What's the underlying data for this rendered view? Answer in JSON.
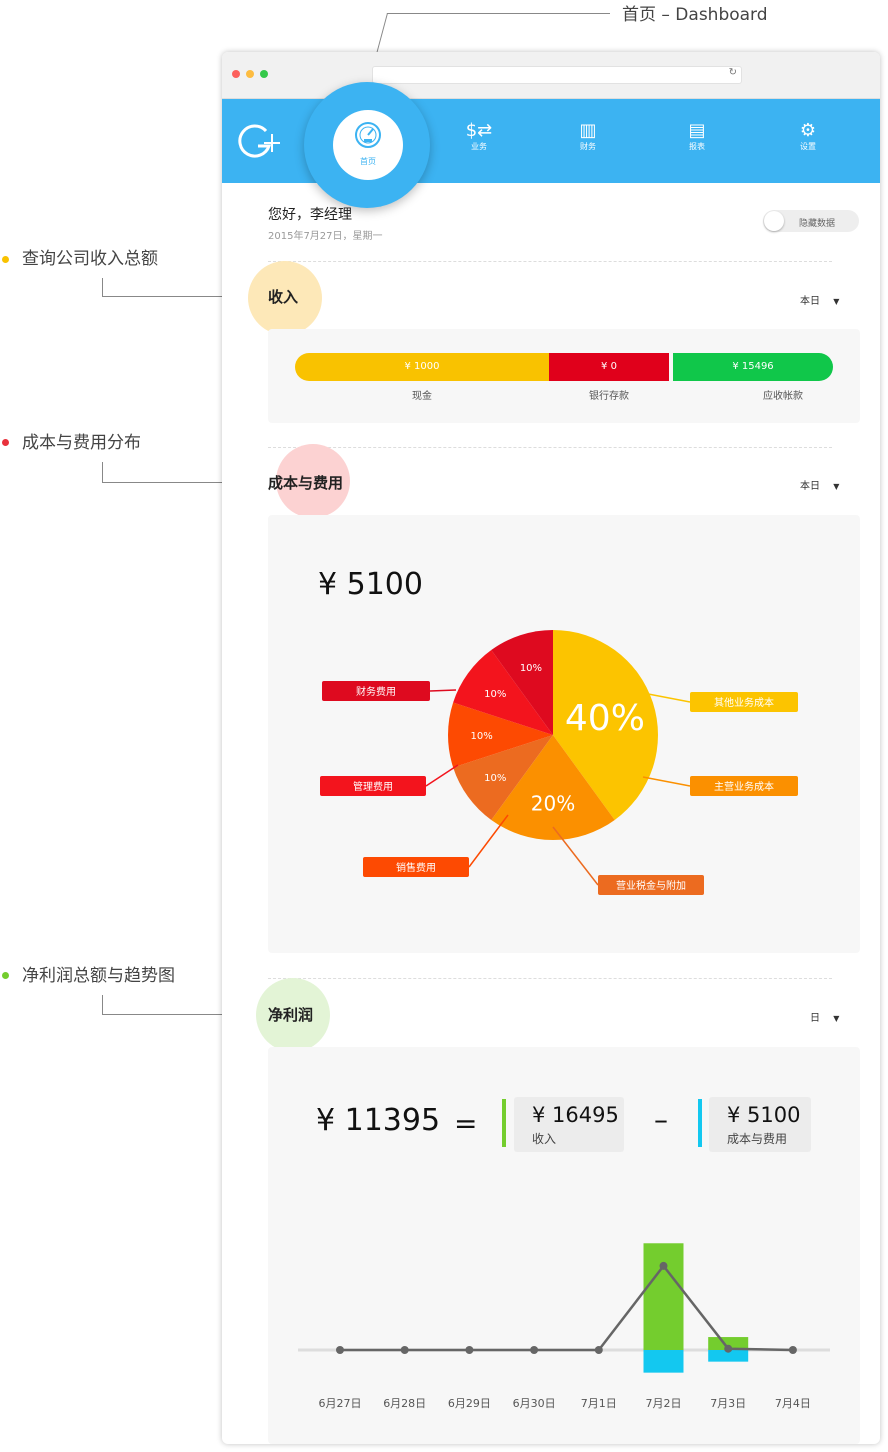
{
  "annotations": {
    "dashboard": "首页 – Dashboard",
    "income": "查询公司收入总额",
    "cost": "成本与费用分布",
    "profit": "净利润总额与趋势图"
  },
  "nav": {
    "home": "首页",
    "business": "业务",
    "finance": "财务",
    "report": "报表",
    "settings": "设置"
  },
  "greeting": {
    "name": "您好，李经理",
    "date": "2015年7月27日，星期一",
    "toggle_label": "隐藏数据"
  },
  "income": {
    "title": "收入",
    "period": "本日",
    "segments": [
      {
        "value": "¥ 1000",
        "label": "现金",
        "color": "#f9c200",
        "amount": 1000
      },
      {
        "value": "¥ 0",
        "label": "银行存款",
        "color": "#e0001b",
        "amount": 0
      },
      {
        "value": "¥ 15496",
        "label": "应收帐款",
        "color": "#10c74a",
        "amount": 15496
      }
    ]
  },
  "cost": {
    "title": "成本与费用",
    "period": "本日",
    "total": "¥ 5100"
  },
  "profit": {
    "title": "净利润",
    "period": "日",
    "total": "¥ 11395",
    "equals": "=",
    "minus": "–",
    "income_value": "¥ 16495",
    "income_label": "收入",
    "cost_value": "¥ 5100",
    "cost_label": "成本与费用"
  },
  "chart_data": [
    {
      "type": "pie",
      "title": "",
      "slices": [
        {
          "label": "其他业务成本",
          "value": 40,
          "text": "40%",
          "color": "#fcc400"
        },
        {
          "label": "主营业务成本",
          "value": 20,
          "text": "20%",
          "color": "#fb9000"
        },
        {
          "label": "营业税金与附加",
          "value": 10,
          "text": "10%",
          "color": "#ec6b20"
        },
        {
          "label": "销售费用",
          "value": 10,
          "text": "10%",
          "color": "#fd4a02"
        },
        {
          "label": "管理费用",
          "value": 10,
          "text": "10%",
          "color": "#f3141d"
        },
        {
          "label": "财务费用",
          "value": 10,
          "text": "10%",
          "color": "#de0a1f"
        }
      ]
    },
    {
      "type": "bar",
      "title": "",
      "categories": [
        "6月27日",
        "6月28日",
        "6月29日",
        "6月30日",
        "7月1日",
        "7月2日",
        "7月3日",
        "7月4日"
      ],
      "series": [
        {
          "name": "收入",
          "values": [
            0,
            0,
            0,
            0,
            0,
            16495,
            2000,
            0
          ],
          "color": "#74cd2e"
        },
        {
          "name": "成本与费用",
          "values": [
            0,
            0,
            0,
            0,
            0,
            -3500,
            -1800,
            0
          ],
          "color": "#13c8f0"
        },
        {
          "name": "净利润",
          "values": [
            0,
            0,
            0,
            0,
            0,
            12995,
            200,
            0
          ],
          "color": "#666666"
        }
      ],
      "ylim": [
        -5000,
        17000
      ]
    }
  ]
}
